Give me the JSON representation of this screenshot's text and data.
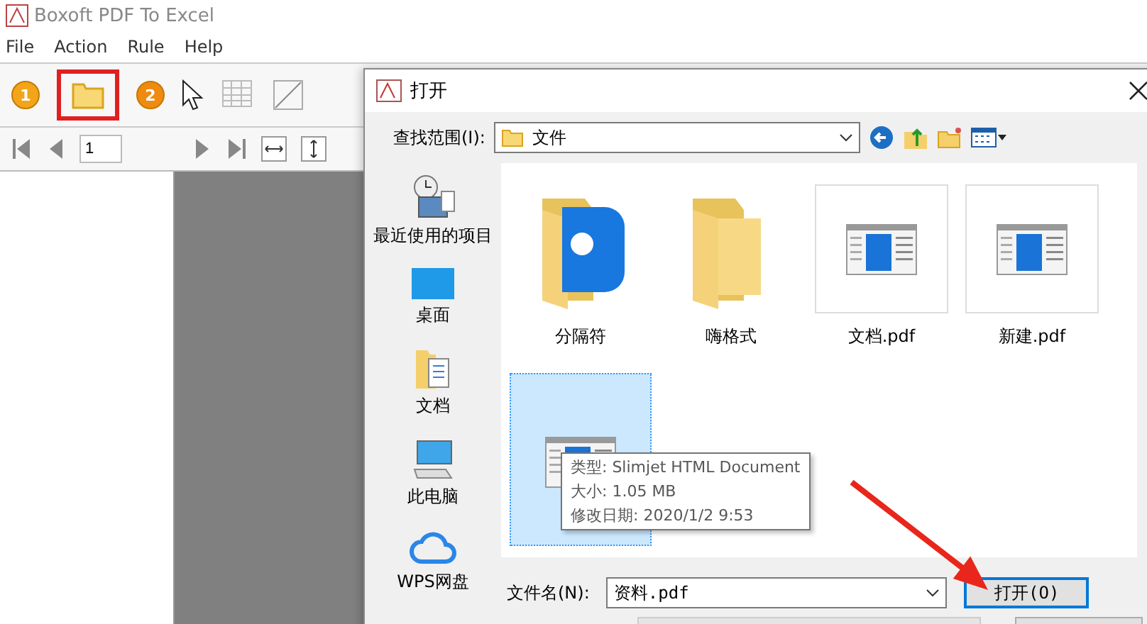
{
  "app": {
    "title": "Boxoft PDF To Excel",
    "menu": [
      "File",
      "Action",
      "Rule",
      "Help"
    ],
    "step_badges": [
      "1",
      "2"
    ],
    "page_field": {
      "value": "1"
    }
  },
  "dialog": {
    "title": "打开",
    "look_in": {
      "label": "查找范围(I):",
      "value": "文件"
    },
    "places": [
      {
        "label": "最近使用的项目",
        "kind": "recent"
      },
      {
        "label": "桌面",
        "kind": "desktop"
      },
      {
        "label": "文档",
        "kind": "documents"
      },
      {
        "label": "此电脑",
        "kind": "computer"
      },
      {
        "label": "WPS网盘",
        "kind": "cloud"
      }
    ],
    "files": [
      {
        "name": "分隔符",
        "kind": "app-folder",
        "selected": false
      },
      {
        "name": "嗨格式",
        "kind": "folder",
        "selected": false
      },
      {
        "name": "文档.pdf",
        "kind": "document",
        "selected": false
      },
      {
        "name": "新建.pdf",
        "kind": "document",
        "selected": false
      },
      {
        "kind": "document",
        "selected": true
      }
    ],
    "tooltip": [
      "类型: Slimjet HTML Document",
      "大小: 1.05 MB",
      "修改日期: 2020/1/2 9:53"
    ],
    "file_name": {
      "label": "文件名(N):",
      "value": "资料.pdf"
    },
    "open_button": "打开(O)"
  }
}
